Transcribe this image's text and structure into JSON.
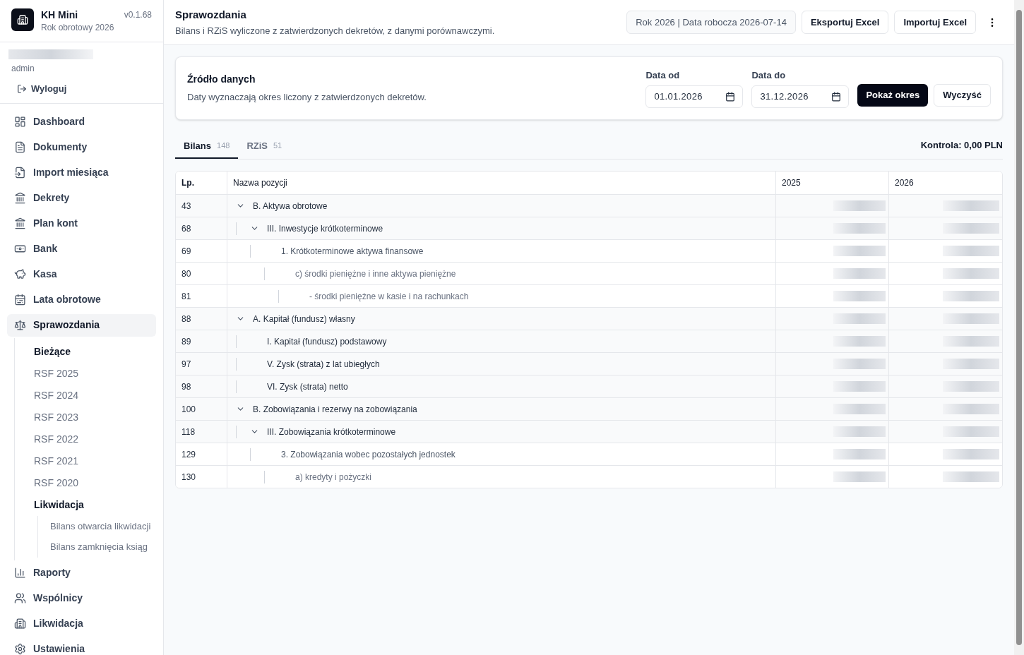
{
  "app": {
    "name": "KH Mini",
    "version": "v0.1.68",
    "subtitle": "Rok obrotowy 2026"
  },
  "user": {
    "role": "admin",
    "logout": "Wyloguj"
  },
  "nav": [
    {
      "label": "Dashboard",
      "selected": false
    },
    {
      "label": "Dokumenty",
      "selected": false
    },
    {
      "label": "Import miesiąca",
      "selected": false
    },
    {
      "label": "Dekrety",
      "selected": false
    },
    {
      "label": "Plan kont",
      "selected": false
    },
    {
      "label": "Bank",
      "selected": false
    },
    {
      "label": "Kasa",
      "selected": false
    },
    {
      "label": "Lata obrotowe",
      "selected": false
    },
    {
      "label": "Sprawozdania",
      "selected": true,
      "expanded": true,
      "children": [
        {
          "kind": "link",
          "label": "Bieżące",
          "selected": true
        },
        {
          "kind": "link",
          "label": "RSF 2025",
          "selected": false
        },
        {
          "kind": "link",
          "label": "RSF 2024",
          "selected": false
        },
        {
          "kind": "link",
          "label": "RSF 2023",
          "selected": false
        },
        {
          "kind": "link",
          "label": "RSF 2022",
          "selected": false
        },
        {
          "kind": "link",
          "label": "RSF 2021",
          "selected": false
        },
        {
          "kind": "link",
          "label": "RSF 2020",
          "selected": false
        },
        {
          "kind": "group",
          "label": "Likwidacja",
          "children": [
            {
              "label": "Bilans otwarcia likwidacji",
              "selected": false
            },
            {
              "label": "Bilans zamknięcia ksiąg",
              "selected": false
            }
          ]
        }
      ]
    },
    {
      "label": "Raporty",
      "selected": false
    },
    {
      "label": "Wspólnicy",
      "selected": false
    },
    {
      "label": "Likwidacja",
      "selected": false
    },
    {
      "label": "Ustawienia",
      "selected": false
    }
  ],
  "header": {
    "title": "Sprawozdania",
    "subtitle": "Bilans i RZiS wyliczone z zatwierdzonych dekretów, z danymi porównawczymi.",
    "context": "Rok 2026 | Data robocza 2026-07-14",
    "buttons": [
      "Eksportuj Excel",
      "Importuj Excel"
    ]
  },
  "source": {
    "title": "Źródło danych",
    "description": "Daty wyznaczają okres liczony z zatwierdzonych dekretów.",
    "date_from": {
      "label": "Data od",
      "value": "01.01.2026"
    },
    "date_to": {
      "label": "Data do",
      "value": "31.12.2026"
    },
    "apply": "Pokaż okres",
    "clear": "Wyczyść"
  },
  "tabs": [
    {
      "label": "Bilans",
      "count": "148",
      "selected": true
    },
    {
      "label": "RZiS",
      "count": "51",
      "selected": false
    }
  ],
  "control": "Kontrola: 0,00 PLN",
  "table": {
    "columns": [
      "Lp.",
      "Nazwa pozycji",
      "2025",
      "2026"
    ],
    "rows": [
      {
        "lp": "43",
        "name": "B. Aktywa obrotowe",
        "expanded": true,
        "children": [
          {
            "lp": "68",
            "name": "III. Inwestycje krótkoterminowe",
            "expanded": true,
            "children": [
              {
                "lp": "69",
                "name": "1. Krótkoterminowe aktywa finansowe",
                "children": [
                  {
                    "lp": "80",
                    "name": "c) środki pieniężne i inne aktywa pieniężne",
                    "children": [
                      {
                        "lp": "81",
                        "name": "- środki pieniężne w kasie i na rachunkach"
                      }
                    ]
                  }
                ]
              }
            ]
          }
        ]
      },
      {
        "lp": "88",
        "name": "A. Kapitał (fundusz) własny",
        "expanded": true,
        "children": [
          {
            "lp": "89",
            "name": "I. Kapitał (fundusz) podstawowy"
          },
          {
            "lp": "97",
            "name": "V. Zysk (strata) z lat ubiegłych"
          },
          {
            "lp": "98",
            "name": "VI. Zysk (strata) netto"
          }
        ]
      },
      {
        "lp": "100",
        "name": "B. Zobowiązania i rezerwy na zobowiązania",
        "expanded": true,
        "children": [
          {
            "lp": "118",
            "name": "III. Zobowiązania krótkoterminowe",
            "expanded": true,
            "children": [
              {
                "lp": "129",
                "name": "3. Zobowiązania wobec pozostałych jednostek",
                "children": [
                  {
                    "lp": "130",
                    "name": "a) kredyty i pożyczki"
                  }
                ]
              }
            ]
          }
        ]
      }
    ]
  }
}
